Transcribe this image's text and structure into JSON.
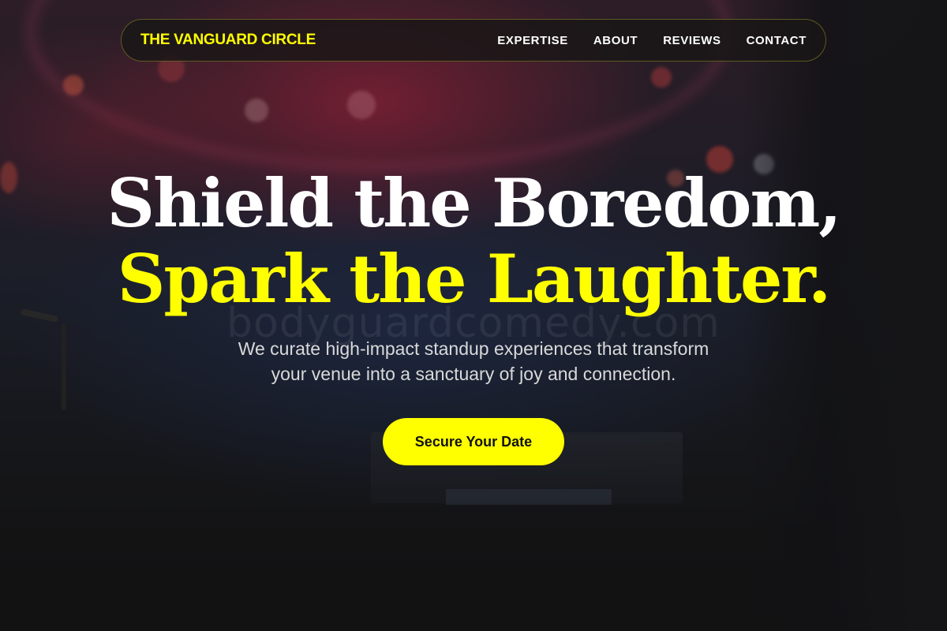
{
  "nav": {
    "brand": "THE VANGUARD CIRCLE",
    "links": [
      "EXPERTISE",
      "ABOUT",
      "REVIEWS",
      "CONTACT"
    ]
  },
  "hero": {
    "line1": "Shield the Boredom,",
    "line2": "Spark the Laughter.",
    "subtitle_line1": "We curate high-impact standup experiences that transform",
    "subtitle_line2": "your venue into a sanctuary of joy and connection.",
    "cta_label": "Secure Your Date"
  },
  "watermark": "bodyguardcomedy.com",
  "colors": {
    "accent": "#ffff00",
    "background": "#161616",
    "text": "#ffffff",
    "subtitle": "#d9d9d9"
  }
}
